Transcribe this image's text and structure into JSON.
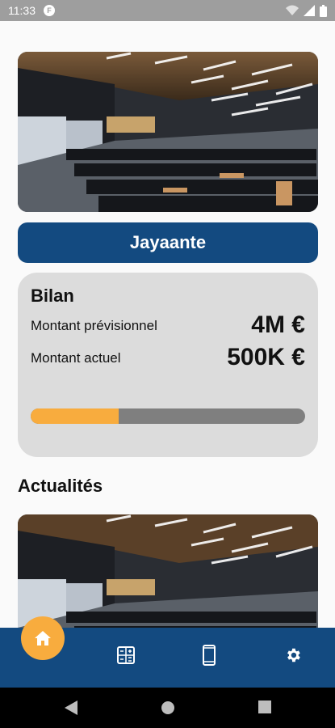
{
  "status_bar": {
    "time": "11:33",
    "app_icon_letter": "F",
    "icons": [
      "wifi-icon",
      "signal-icon",
      "battery-icon"
    ]
  },
  "project": {
    "name": "Jayaante",
    "image": "auditorium-photo"
  },
  "bilan": {
    "title": "Bilan",
    "forecast_label": "Montant prévisionnel",
    "forecast_value": "4M €",
    "current_label": "Montant actuel",
    "current_value": "500K €",
    "progress_fraction": 0.32
  },
  "news": {
    "title": "Actualités",
    "items": [
      {
        "image": "auditorium-photo"
      }
    ]
  },
  "bottom_nav": {
    "items": [
      {
        "icon": "home-icon",
        "active": true
      },
      {
        "icon": "calculator-icon",
        "active": false
      },
      {
        "icon": "phone-icon",
        "active": false
      },
      {
        "icon": "gear-icon",
        "active": false
      }
    ]
  },
  "colors": {
    "primary": "#134a80",
    "accent": "#f8ac3e",
    "card_bg": "#dcdcdc",
    "progress_track": "#7f7f7f"
  }
}
